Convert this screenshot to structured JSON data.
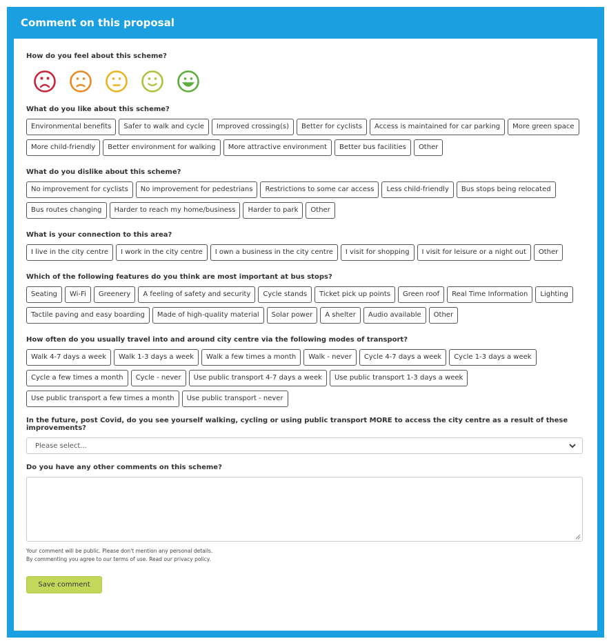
{
  "header": {
    "title": "Comment on this proposal"
  },
  "q_feel": {
    "label": "How do you feel about this scheme?",
    "faces": [
      {
        "icon": "very-sad-face-icon",
        "color": "#c8243a"
      },
      {
        "icon": "sad-face-icon",
        "color": "#ea8a22"
      },
      {
        "icon": "neutral-face-icon",
        "color": "#e8b421"
      },
      {
        "icon": "smile-face-icon",
        "color": "#a9c43d"
      },
      {
        "icon": "big-smile-face-icon",
        "color": "#5cae3c"
      }
    ]
  },
  "q_like": {
    "label": "What do you like about this scheme?",
    "options": [
      "Environmental benefits",
      "Safer to walk and cycle",
      "Improved crossing(s)",
      "Better for cyclists",
      "Access is maintained for car parking",
      "More green space",
      "More child-friendly",
      "Better environment for walking",
      "More attractive environment",
      "Better bus facilities",
      "Other"
    ]
  },
  "q_dislike": {
    "label": "What do you dislike about this scheme?",
    "options": [
      "No improvement for cyclists",
      "No improvement for pedestrians",
      "Restrictions to some car access",
      "Less child-friendly",
      "Bus stops being relocated",
      "Bus routes changing",
      "Harder to reach my home/business",
      "Harder to park",
      "Other"
    ]
  },
  "q_connection": {
    "label": "What is your connection to this area?",
    "options": [
      "I live in the city centre",
      "I work in the city centre",
      "I own a business in the city centre",
      "I visit for shopping",
      "I visit for leisure or a night out",
      "Other"
    ]
  },
  "q_busstops": {
    "label": "Which of the following features do you think are most important at bus stops?",
    "options": [
      "Seating",
      "Wi-Fi",
      "Greenery",
      "A feeling of safety and security",
      "Cycle stands",
      "Ticket pick up points",
      "Green roof",
      "Real Time Information",
      "Lighting",
      "Tactile paving and easy boarding",
      "Made of high-quality material",
      "Solar power",
      "A shelter",
      "Audio available",
      "Other"
    ]
  },
  "q_travel": {
    "label": "How often do you usually travel into and around city centre via the following modes of transport?",
    "options": [
      "Walk 4-7 days a week",
      "Walk 1-3 days a week",
      "Walk a few times a month",
      "Walk - never",
      "Cycle 4-7 days a week",
      "Cycle 1-3 days a week",
      "Cycle a few times a month",
      "Cycle - never",
      "Use public transport 4-7 days a week",
      "Use public transport 1-3 days a week",
      "Use public transport a few times a month",
      "Use public transport - never"
    ]
  },
  "q_future": {
    "label": "In the future, post Covid, do you see yourself walking, cycling or using public transport MORE to access the city centre as a result of these improvements?",
    "select_value": "Please select..."
  },
  "q_comments": {
    "label": "Do you have any other comments on this scheme?"
  },
  "notes": {
    "line1": "Your comment will be public. Please don't mention any personal details.",
    "line2": "By commenting you agree to our terms of use. Read our privacy policy."
  },
  "save_label": "Save comment"
}
